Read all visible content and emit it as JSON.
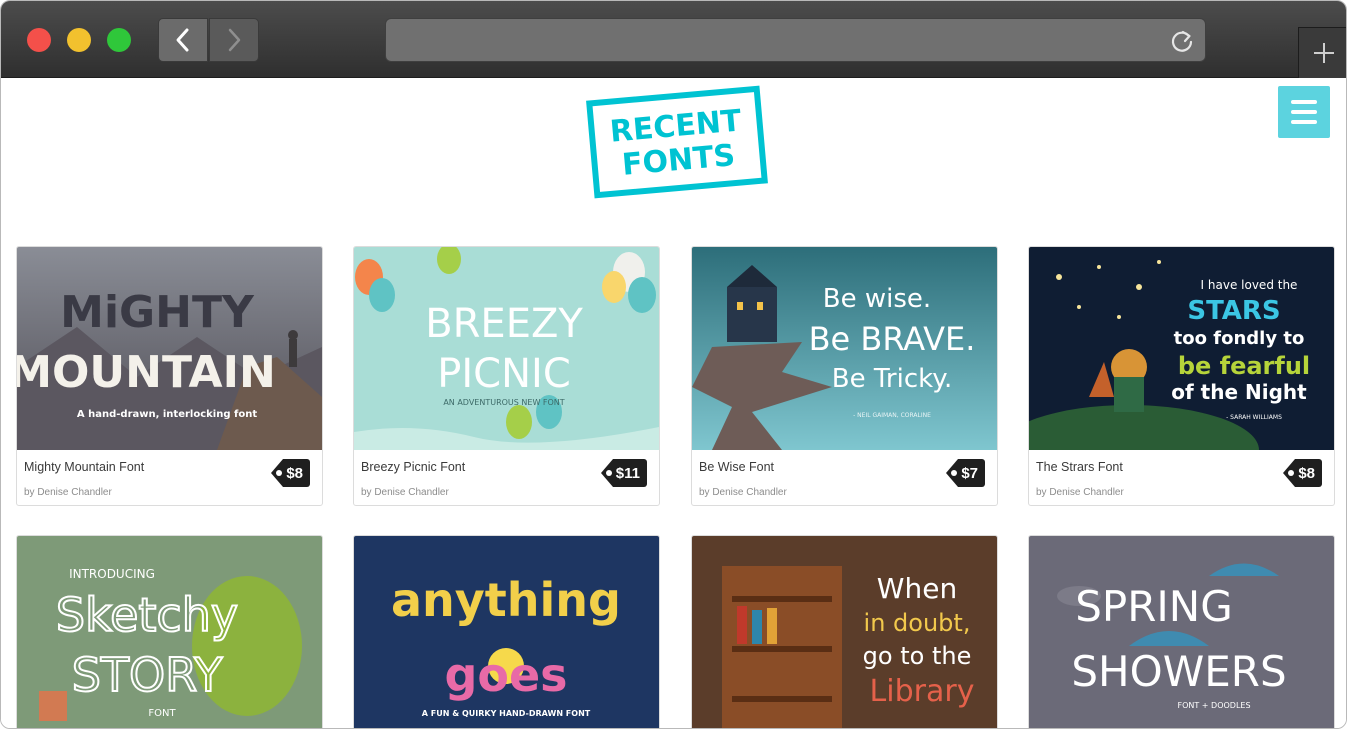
{
  "browser": {
    "back_icon": "chevron-left-icon",
    "forward_icon": "chevron-right-icon",
    "reload_icon": "reload-icon",
    "newtab_icon": "plus-icon"
  },
  "site": {
    "logo_line1": "RECENT",
    "logo_line2": "FONTS",
    "accent": "#00c3d2",
    "menu_icon": "hamburger-menu-icon"
  },
  "cards": [
    {
      "title": "Mighty Mountain Font",
      "author": "by Denise Chandler",
      "price": "$8",
      "art": {
        "line1": "MiGHTY",
        "line2": "MOUNTAIN",
        "sub": "A hand-drawn, interlocking font"
      }
    },
    {
      "title": "Breezy Picnic Font",
      "author": "by Denise Chandler",
      "price": "$11",
      "art": {
        "line1": "BREEZY",
        "line2": "PICNIC",
        "sub": "AN ADVENTUROUS NEW FONT"
      }
    },
    {
      "title": "Be Wise Font",
      "author": "by Denise Chandler",
      "price": "$7",
      "art": {
        "line1": "Be wise.",
        "line2": "Be BRAVE.",
        "line3": "Be Tricky.",
        "sub": "- NEIL GAIMAN, CORALINE"
      }
    },
    {
      "title": "The Strars Font",
      "author": "by Denise Chandler",
      "price": "$8",
      "art": {
        "line1": "I have loved the",
        "line2": "STARS",
        "line3": "too fondly to",
        "line4": "be fearful",
        "line5": "of the Night",
        "sub": "- SARAH WILLIAMS"
      }
    },
    {
      "art": {
        "line1": "INTRODUCING",
        "line2": "Sketchy",
        "line3": "STORY",
        "sub": "FONT"
      }
    },
    {
      "art": {
        "line1": "anything",
        "line2": "goes",
        "sub": "A FUN & QUIRKY HAND-DRAWN FONT"
      }
    },
    {
      "art": {
        "line1": "When",
        "line2": "in doubt,",
        "line3": "go to the",
        "line4": "Library"
      }
    },
    {
      "art": {
        "line1": "SPRING",
        "line2": "SHOWERS",
        "sub": "FONT + DOODLES"
      }
    }
  ]
}
